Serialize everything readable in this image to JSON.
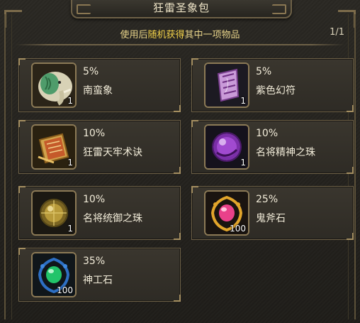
{
  "title": "狂雷圣象包",
  "instruction": {
    "prefix": "使用后",
    "highlight": "随机获得",
    "suffix": "其中一项物品"
  },
  "page": "1/1",
  "items": [
    {
      "chance": "5%",
      "name": "南蛮象",
      "count": "1",
      "icon": "elephant-icon"
    },
    {
      "chance": "5%",
      "name": "紫色幻符",
      "count": "1",
      "icon": "purple-talisman-icon"
    },
    {
      "chance": "10%",
      "name": "狂雷天牢术诀",
      "count": "1",
      "icon": "scroll-book-icon"
    },
    {
      "chance": "10%",
      "name": "名将精神之珠",
      "count": "1",
      "icon": "purple-orb-icon"
    },
    {
      "chance": "10%",
      "name": "名将统御之珠",
      "count": "1",
      "icon": "gold-orb-icon"
    },
    {
      "chance": "25%",
      "name": "鬼斧石",
      "count": "100",
      "icon": "pink-gem-icon"
    },
    {
      "chance": "35%",
      "name": "神工石",
      "count": "100",
      "icon": "green-gem-icon"
    }
  ],
  "colors": {
    "frame": "#6e6147",
    "highlight_text": "#f5d44a",
    "instruction_text": "#e8d48a"
  }
}
